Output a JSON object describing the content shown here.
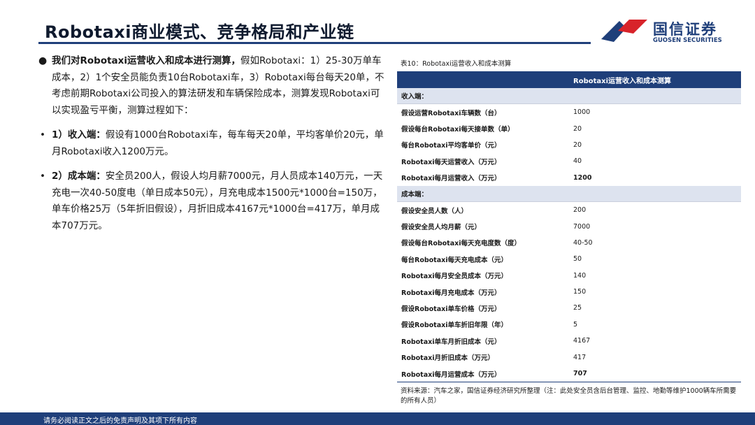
{
  "header": {
    "title": "Robotaxi商业模式、竞争格局和产业链",
    "logo_cn": "国信证券",
    "logo_en": "GUOSEN SECURITIES"
  },
  "left": {
    "p1_bold": "我们对Robotaxi运营收入和成本进行测算，",
    "p1_text": "假如Robotaxi：1）25-30万单车成本，2）1个安全员能负责10台Robotaxi车，3）Robotaxi每台每天20单，不考虑前期Robotaxi公司投入的算法研发和车辆保险成本，测算发现Robotaxi可以实现盈亏平衡，测算过程如下：",
    "p2_bold": "1）收入端：",
    "p2_text": "假设有1000台Robotaxi车，每车每天20单，平均客单价20元，单月Robotaxi收入1200万元。",
    "p3_bold": "2）成本端：",
    "p3_text": "安全员200人，假设人均月薪7000元，月人员成本140万元，一天充电一次40-50度电（单日成本50元），月充电成本1500元*1000台=150万，单车价格25万（5年折旧假设），月折旧成本4167元*1000台=417万，单月成本707万元。"
  },
  "table": {
    "caption": "表10：Robotaxi运营收入和成本测算",
    "header": "Robotaxi运营收入和成本测算",
    "income_label": "收入端：",
    "income_rows": [
      {
        "k": "假设运营Robotaxi车辆数（台）",
        "v": "1000"
      },
      {
        "k": "假设每台Robotaxi每天接单数（单）",
        "v": "20"
      },
      {
        "k": "每台Robotaxi平均客单价（元）",
        "v": "20"
      },
      {
        "k": "Robotaxi每天运营收入（万元）",
        "v": "40"
      },
      {
        "k": "Robotaxi每月运营收入（万元）",
        "v": "1200"
      }
    ],
    "cost_label": "成本端：",
    "cost_rows": [
      {
        "k": "假设安全员人数（人）",
        "v": "200"
      },
      {
        "k": "假设安全员人均月薪（元）",
        "v": "7000"
      },
      {
        "k": "假设每台Robotaxi每天充电度数（度）",
        "v": "40-50"
      },
      {
        "k": "每台Robotaxi每天充电成本（元）",
        "v": "50"
      },
      {
        "k": "Robotaxi每月安全员成本（万元）",
        "v": "140"
      },
      {
        "k": "Robotaxi每月充电成本（万元）",
        "v": "150"
      },
      {
        "k": "假设Robotaxi单车价格（万元）",
        "v": "25"
      },
      {
        "k": "假设Robotaxi单车折旧年限（年）",
        "v": "5"
      },
      {
        "k": "Robotaxi单车月折旧成本（元）",
        "v": "4167"
      },
      {
        "k": "Robotaxi月折旧成本（万元）",
        "v": "417"
      },
      {
        "k": "Robotaxi每月运营成本（万元）",
        "v": "707"
      }
    ],
    "source": "资料来源：汽车之家，国信证券经济研究所整理（注：此处安全员含后台管理、监控、地勤等维护1000辆车所需要的所有人员）"
  },
  "footer": {
    "text": "请务必阅读正文之后的免责声明及其项下所有内容"
  },
  "colors": {
    "brand_navy": "#1f3f7a",
    "logo_red": "#d8232a",
    "section_bg": "#dde3ef"
  }
}
